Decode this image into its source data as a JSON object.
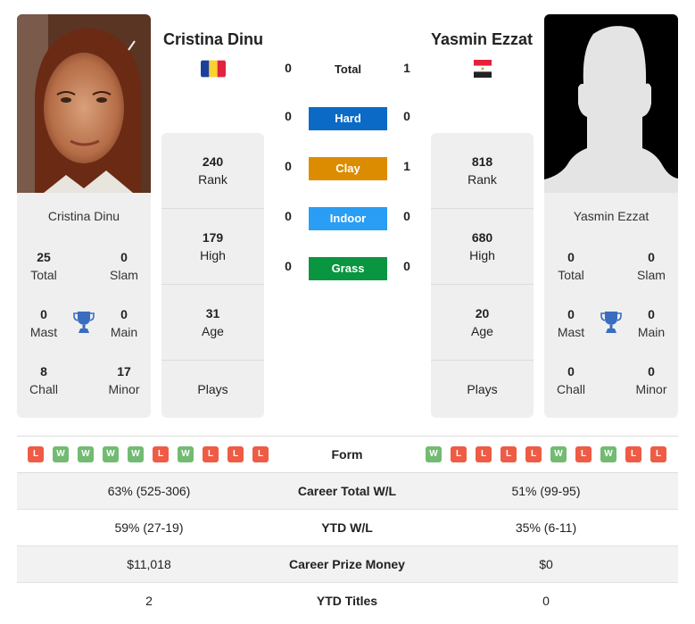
{
  "colors": {
    "hard": "#0a6ac6",
    "clay": "#dc8c00",
    "indoor": "#2a9df4",
    "grass": "#0a9540",
    "win": "#72bb72",
    "loss": "#ef5b45",
    "trophy": "#3a6cbf"
  },
  "player1": {
    "name": "Cristina Dinu",
    "country_flag": "romania-flag",
    "photo": "player-photo",
    "titles": {
      "total": {
        "value": "25",
        "label": "Total"
      },
      "slam": {
        "value": "0",
        "label": "Slam"
      },
      "mast": {
        "value": "0",
        "label": "Mast"
      },
      "main": {
        "value": "0",
        "label": "Main"
      },
      "chall": {
        "value": "8",
        "label": "Chall"
      },
      "minor": {
        "value": "17",
        "label": "Minor"
      }
    },
    "stats": {
      "rank": {
        "value": "240",
        "label": "Rank"
      },
      "high": {
        "value": "179",
        "label": "High"
      },
      "age": {
        "value": "31",
        "label": "Age"
      },
      "plays": {
        "value": "",
        "label": "Plays"
      }
    },
    "form": [
      "L",
      "W",
      "W",
      "W",
      "W",
      "L",
      "W",
      "L",
      "L",
      "L"
    ]
  },
  "player2": {
    "name": "Yasmin Ezzat",
    "country_flag": "egypt-flag",
    "photo": "silhouette-placeholder",
    "titles": {
      "total": {
        "value": "0",
        "label": "Total"
      },
      "slam": {
        "value": "0",
        "label": "Slam"
      },
      "mast": {
        "value": "0",
        "label": "Mast"
      },
      "main": {
        "value": "0",
        "label": "Main"
      },
      "chall": {
        "value": "0",
        "label": "Chall"
      },
      "minor": {
        "value": "0",
        "label": "Minor"
      }
    },
    "stats": {
      "rank": {
        "value": "818",
        "label": "Rank"
      },
      "high": {
        "value": "680",
        "label": "High"
      },
      "age": {
        "value": "20",
        "label": "Age"
      },
      "plays": {
        "value": "",
        "label": "Plays"
      }
    },
    "form": [
      "W",
      "L",
      "L",
      "L",
      "L",
      "W",
      "L",
      "W",
      "L",
      "L"
    ]
  },
  "h2h": {
    "total": {
      "label": "Total",
      "p1": "0",
      "p2": "1"
    },
    "surfaces": [
      {
        "label": "Hard",
        "p1": "0",
        "p2": "0"
      },
      {
        "label": "Clay",
        "p1": "0",
        "p2": "1"
      },
      {
        "label": "Indoor",
        "p1": "0",
        "p2": "0"
      },
      {
        "label": "Grass",
        "p1": "0",
        "p2": "0"
      }
    ]
  },
  "form_label": "Form",
  "comparison": [
    {
      "label": "Career Total W/L",
      "p1": "63% (525-306)",
      "p2": "51% (99-95)"
    },
    {
      "label": "YTD W/L",
      "p1": "59% (27-19)",
      "p2": "35% (6-11)"
    },
    {
      "label": "Career Prize Money",
      "p1": "$11,018",
      "p2": "$0"
    },
    {
      "label": "YTD Titles",
      "p1": "2",
      "p2": "0"
    }
  ]
}
